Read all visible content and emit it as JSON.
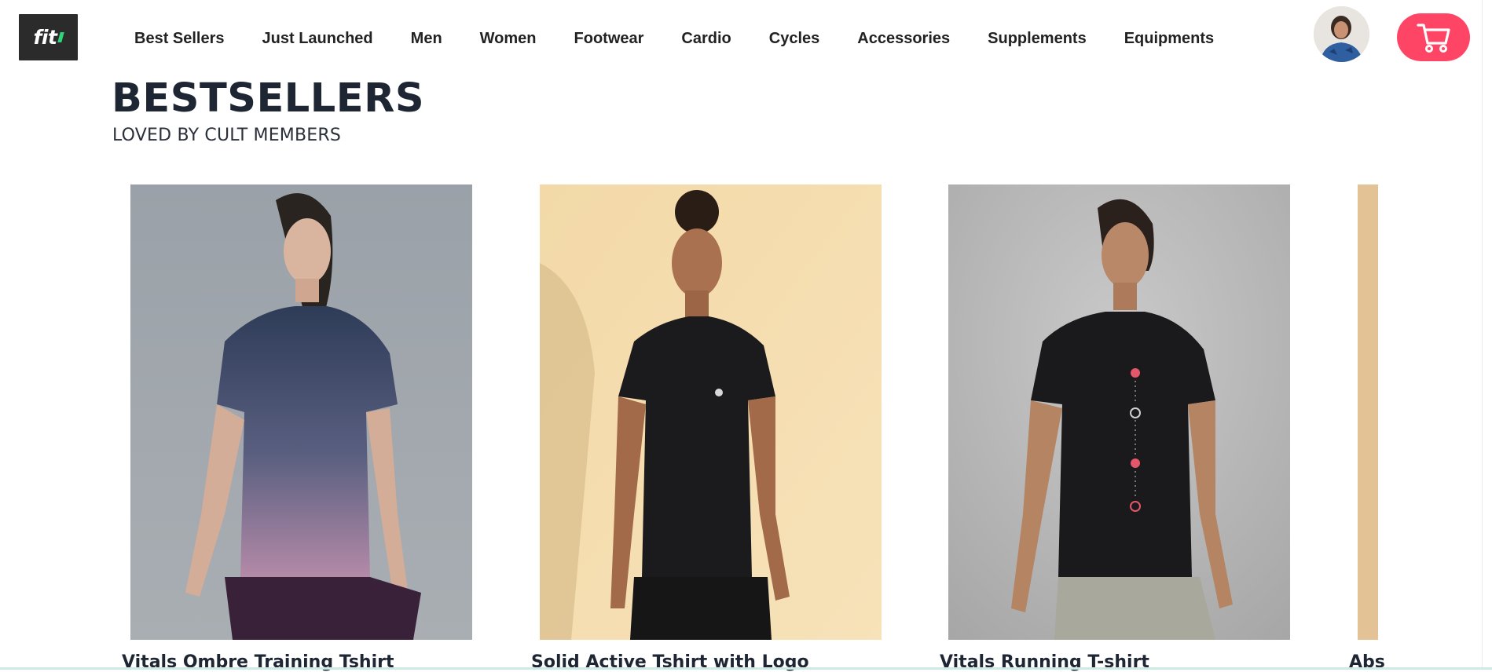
{
  "header": {
    "logo_text": "fit",
    "nav_items": [
      "Best Sellers",
      "Just Launched",
      "Men",
      "Women",
      "Footwear",
      "Cardio",
      "Cycles",
      "Accessories",
      "Supplements",
      "Equipments"
    ],
    "avatar_icon": "user-avatar",
    "cart_icon": "cart-icon",
    "accent_color": "#ff4565"
  },
  "section": {
    "title": "BESTSELLERS",
    "subtitle": "LOVED BY CULT MEMBERS"
  },
  "products": [
    {
      "title": "Vitals Ombre Training Tshirt"
    },
    {
      "title": "Solid Active Tshirt with Logo"
    },
    {
      "title": "Vitals Running T-shirt"
    },
    {
      "title": "Abs"
    }
  ]
}
